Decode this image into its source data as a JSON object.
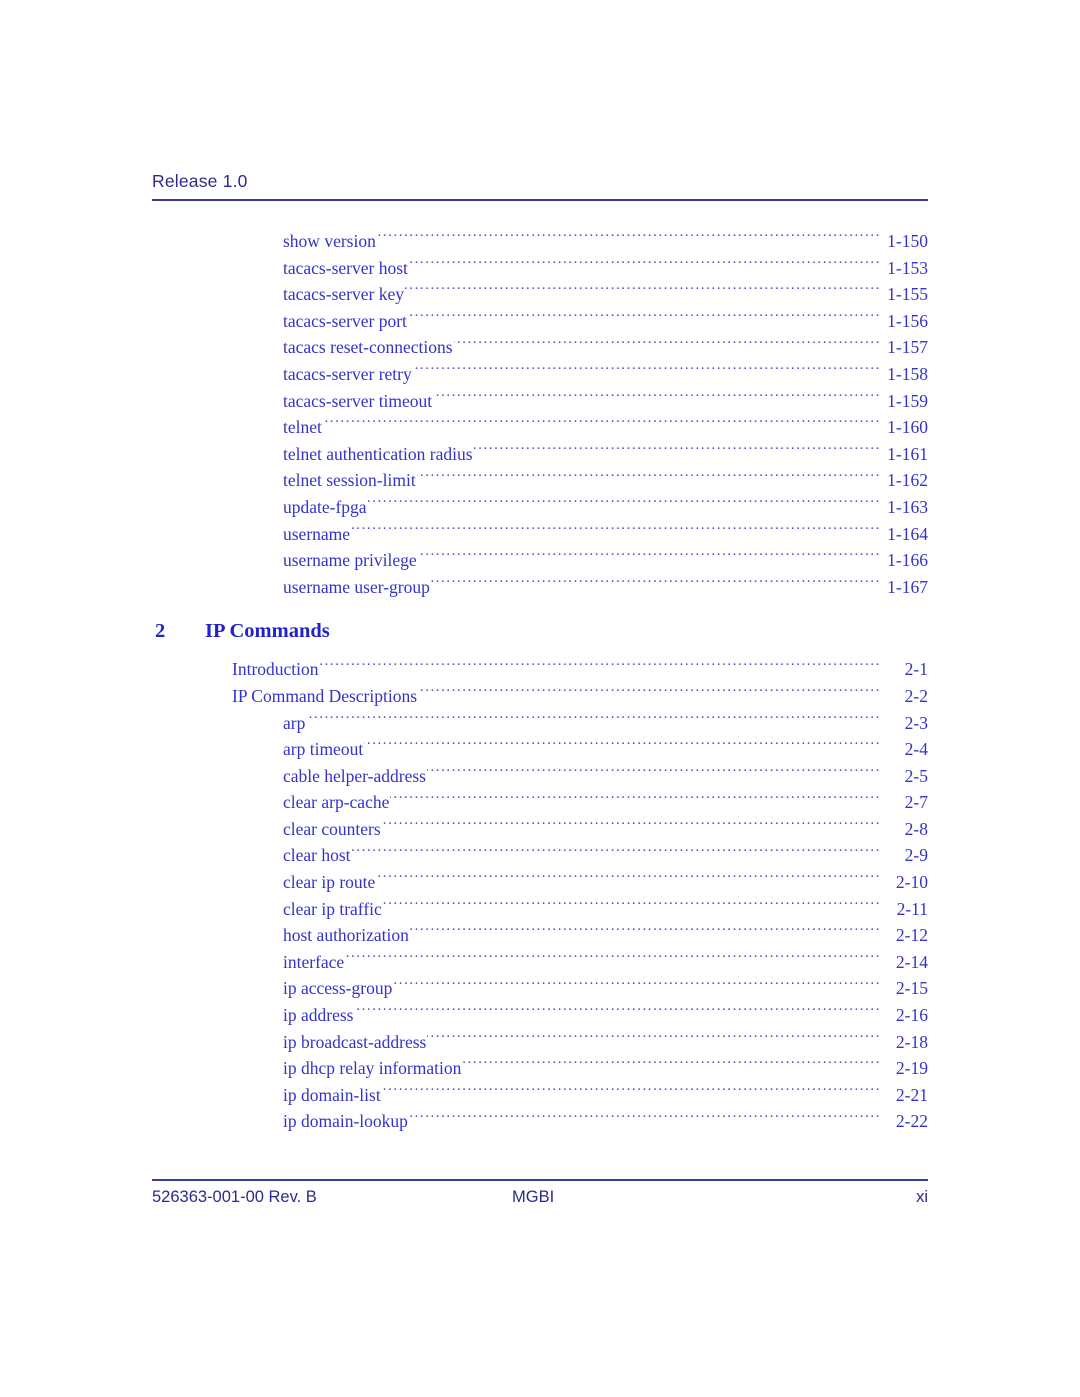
{
  "document": {
    "header_title": "Release 1.0",
    "type": "table-of-contents"
  },
  "toc": {
    "entries_before_chapter": [
      {
        "label": "show version",
        "page": "1-150",
        "level": 2
      },
      {
        "label": "tacacs-server host",
        "page": "1-153",
        "level": 2
      },
      {
        "label": "tacacs-server key",
        "page": "1-155",
        "level": 2
      },
      {
        "label": "tacacs-server port",
        "page": "1-156",
        "level": 2
      },
      {
        "label": "tacacs reset-connections",
        "page": "1-157",
        "level": 2
      },
      {
        "label": "tacacs-server retry",
        "page": "1-158",
        "level": 2
      },
      {
        "label": "tacacs-server timeout",
        "page": "1-159",
        "level": 2
      },
      {
        "label": "telnet",
        "page": "1-160",
        "level": 2
      },
      {
        "label": "telnet authentication radius",
        "page": "1-161",
        "level": 2
      },
      {
        "label": "telnet session-limit",
        "page": "1-162",
        "level": 2
      },
      {
        "label": "update-fpga",
        "page": "1-163",
        "level": 2
      },
      {
        "label": "username",
        "page": "1-164",
        "level": 2
      },
      {
        "label": "username privilege",
        "page": "1-166",
        "level": 2
      },
      {
        "label": "username user-group",
        "page": "1-167",
        "level": 2
      }
    ],
    "chapter": {
      "number": "2",
      "title": "IP Commands"
    },
    "entries_after_chapter": [
      {
        "label": "Introduction",
        "page": "2-1",
        "level": 1
      },
      {
        "label": "IP Command Descriptions",
        "page": "2-2",
        "level": 1
      },
      {
        "label": "arp",
        "page": "2-3",
        "level": 2
      },
      {
        "label": "arp timeout",
        "page": "2-4",
        "level": 2
      },
      {
        "label": "cable helper-address",
        "page": "2-5",
        "level": 2
      },
      {
        "label": "clear arp-cache",
        "page": "2-7",
        "level": 2
      },
      {
        "label": "clear counters",
        "page": "2-8",
        "level": 2
      },
      {
        "label": "clear host",
        "page": "2-9",
        "level": 2
      },
      {
        "label": "clear ip route",
        "page": "2-10",
        "level": 2
      },
      {
        "label": "clear ip traffic",
        "page": "2-11",
        "level": 2
      },
      {
        "label": "host authorization",
        "page": "2-12",
        "level": 2
      },
      {
        "label": "interface",
        "page": "2-14",
        "level": 2
      },
      {
        "label": "ip access-group",
        "page": "2-15",
        "level": 2
      },
      {
        "label": "ip address",
        "page": "2-16",
        "level": 2
      },
      {
        "label": "ip broadcast-address",
        "page": "2-18",
        "level": 2
      },
      {
        "label": "ip dhcp relay information",
        "page": "2-19",
        "level": 2
      },
      {
        "label": "ip domain-list",
        "page": "2-21",
        "level": 2
      },
      {
        "label": "ip domain-lookup",
        "page": "2-22",
        "level": 2
      }
    ]
  },
  "footer": {
    "doc_number": "526363-001-00 Rev. B",
    "product": "MGBI",
    "page_label": "xi"
  },
  "colors": {
    "body_text": "#3333cc",
    "header_text": "#2b2b8f",
    "heading_text": "#2222cc",
    "rule": "#3b3b9c",
    "background": "#ffffff"
  }
}
